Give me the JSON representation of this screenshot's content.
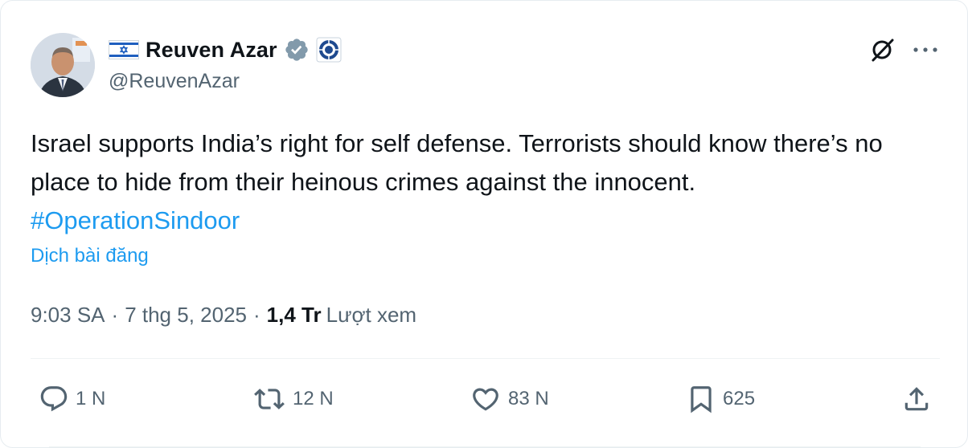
{
  "author": {
    "display_name": "Reuven Azar",
    "handle": "@ReuvenAzar",
    "flag_icon": "israel-flag-icon",
    "verified_icon": "verified-badge-icon",
    "affiliate_icon": "government-affiliate-icon"
  },
  "tweet": {
    "text": "Israel supports India’s right for self defense. Terrorists should know there’s no place to hide from their heinous crimes against the innocent.",
    "hashtag": "#OperationSindoor",
    "translate_label": "Dịch bài đăng"
  },
  "meta": {
    "time": "9:03 SA",
    "separator": "·",
    "date": "7 thg 5, 2025",
    "views_count": "1,4 Tr",
    "views_label": "Lượt xem"
  },
  "actions": {
    "reply_count": "1 N",
    "repost_count": "12 N",
    "like_count": "83 N",
    "bookmark_count": "625"
  },
  "colors": {
    "text": "#0f1419",
    "secondary": "#536471",
    "link": "#1d9bf0",
    "verified": "#829aab"
  }
}
